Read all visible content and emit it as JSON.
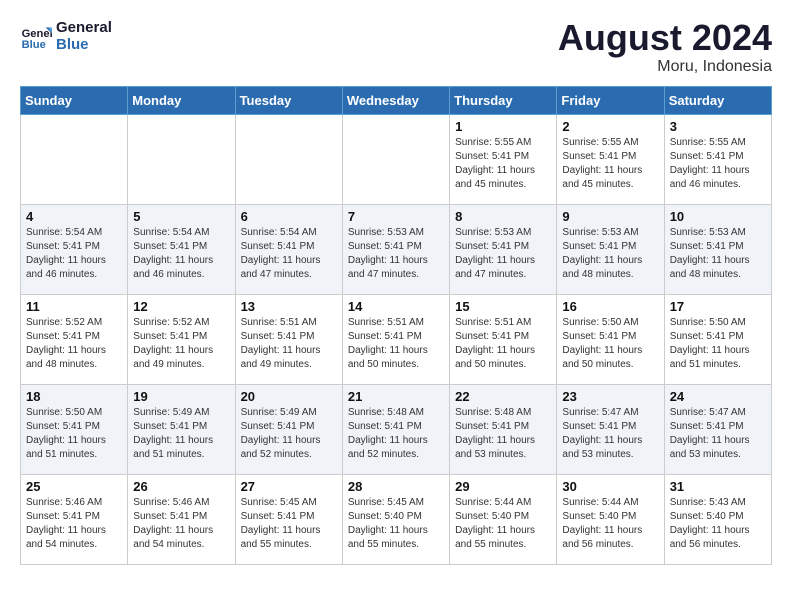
{
  "header": {
    "logo_line1": "General",
    "logo_line2": "Blue",
    "month_year": "August 2024",
    "location": "Moru, Indonesia"
  },
  "days_of_week": [
    "Sunday",
    "Monday",
    "Tuesday",
    "Wednesday",
    "Thursday",
    "Friday",
    "Saturday"
  ],
  "weeks": [
    [
      {
        "day": "",
        "info": ""
      },
      {
        "day": "",
        "info": ""
      },
      {
        "day": "",
        "info": ""
      },
      {
        "day": "",
        "info": ""
      },
      {
        "day": "1",
        "info": "Sunrise: 5:55 AM\nSunset: 5:41 PM\nDaylight: 11 hours\nand 45 minutes."
      },
      {
        "day": "2",
        "info": "Sunrise: 5:55 AM\nSunset: 5:41 PM\nDaylight: 11 hours\nand 45 minutes."
      },
      {
        "day": "3",
        "info": "Sunrise: 5:55 AM\nSunset: 5:41 PM\nDaylight: 11 hours\nand 46 minutes."
      }
    ],
    [
      {
        "day": "4",
        "info": "Sunrise: 5:54 AM\nSunset: 5:41 PM\nDaylight: 11 hours\nand 46 minutes."
      },
      {
        "day": "5",
        "info": "Sunrise: 5:54 AM\nSunset: 5:41 PM\nDaylight: 11 hours\nand 46 minutes."
      },
      {
        "day": "6",
        "info": "Sunrise: 5:54 AM\nSunset: 5:41 PM\nDaylight: 11 hours\nand 47 minutes."
      },
      {
        "day": "7",
        "info": "Sunrise: 5:53 AM\nSunset: 5:41 PM\nDaylight: 11 hours\nand 47 minutes."
      },
      {
        "day": "8",
        "info": "Sunrise: 5:53 AM\nSunset: 5:41 PM\nDaylight: 11 hours\nand 47 minutes."
      },
      {
        "day": "9",
        "info": "Sunrise: 5:53 AM\nSunset: 5:41 PM\nDaylight: 11 hours\nand 48 minutes."
      },
      {
        "day": "10",
        "info": "Sunrise: 5:53 AM\nSunset: 5:41 PM\nDaylight: 11 hours\nand 48 minutes."
      }
    ],
    [
      {
        "day": "11",
        "info": "Sunrise: 5:52 AM\nSunset: 5:41 PM\nDaylight: 11 hours\nand 48 minutes."
      },
      {
        "day": "12",
        "info": "Sunrise: 5:52 AM\nSunset: 5:41 PM\nDaylight: 11 hours\nand 49 minutes."
      },
      {
        "day": "13",
        "info": "Sunrise: 5:51 AM\nSunset: 5:41 PM\nDaylight: 11 hours\nand 49 minutes."
      },
      {
        "day": "14",
        "info": "Sunrise: 5:51 AM\nSunset: 5:41 PM\nDaylight: 11 hours\nand 50 minutes."
      },
      {
        "day": "15",
        "info": "Sunrise: 5:51 AM\nSunset: 5:41 PM\nDaylight: 11 hours\nand 50 minutes."
      },
      {
        "day": "16",
        "info": "Sunrise: 5:50 AM\nSunset: 5:41 PM\nDaylight: 11 hours\nand 50 minutes."
      },
      {
        "day": "17",
        "info": "Sunrise: 5:50 AM\nSunset: 5:41 PM\nDaylight: 11 hours\nand 51 minutes."
      }
    ],
    [
      {
        "day": "18",
        "info": "Sunrise: 5:50 AM\nSunset: 5:41 PM\nDaylight: 11 hours\nand 51 minutes."
      },
      {
        "day": "19",
        "info": "Sunrise: 5:49 AM\nSunset: 5:41 PM\nDaylight: 11 hours\nand 51 minutes."
      },
      {
        "day": "20",
        "info": "Sunrise: 5:49 AM\nSunset: 5:41 PM\nDaylight: 11 hours\nand 52 minutes."
      },
      {
        "day": "21",
        "info": "Sunrise: 5:48 AM\nSunset: 5:41 PM\nDaylight: 11 hours\nand 52 minutes."
      },
      {
        "day": "22",
        "info": "Sunrise: 5:48 AM\nSunset: 5:41 PM\nDaylight: 11 hours\nand 53 minutes."
      },
      {
        "day": "23",
        "info": "Sunrise: 5:47 AM\nSunset: 5:41 PM\nDaylight: 11 hours\nand 53 minutes."
      },
      {
        "day": "24",
        "info": "Sunrise: 5:47 AM\nSunset: 5:41 PM\nDaylight: 11 hours\nand 53 minutes."
      }
    ],
    [
      {
        "day": "25",
        "info": "Sunrise: 5:46 AM\nSunset: 5:41 PM\nDaylight: 11 hours\nand 54 minutes."
      },
      {
        "day": "26",
        "info": "Sunrise: 5:46 AM\nSunset: 5:41 PM\nDaylight: 11 hours\nand 54 minutes."
      },
      {
        "day": "27",
        "info": "Sunrise: 5:45 AM\nSunset: 5:41 PM\nDaylight: 11 hours\nand 55 minutes."
      },
      {
        "day": "28",
        "info": "Sunrise: 5:45 AM\nSunset: 5:40 PM\nDaylight: 11 hours\nand 55 minutes."
      },
      {
        "day": "29",
        "info": "Sunrise: 5:44 AM\nSunset: 5:40 PM\nDaylight: 11 hours\nand 55 minutes."
      },
      {
        "day": "30",
        "info": "Sunrise: 5:44 AM\nSunset: 5:40 PM\nDaylight: 11 hours\nand 56 minutes."
      },
      {
        "day": "31",
        "info": "Sunrise: 5:43 AM\nSunset: 5:40 PM\nDaylight: 11 hours\nand 56 minutes."
      }
    ]
  ]
}
